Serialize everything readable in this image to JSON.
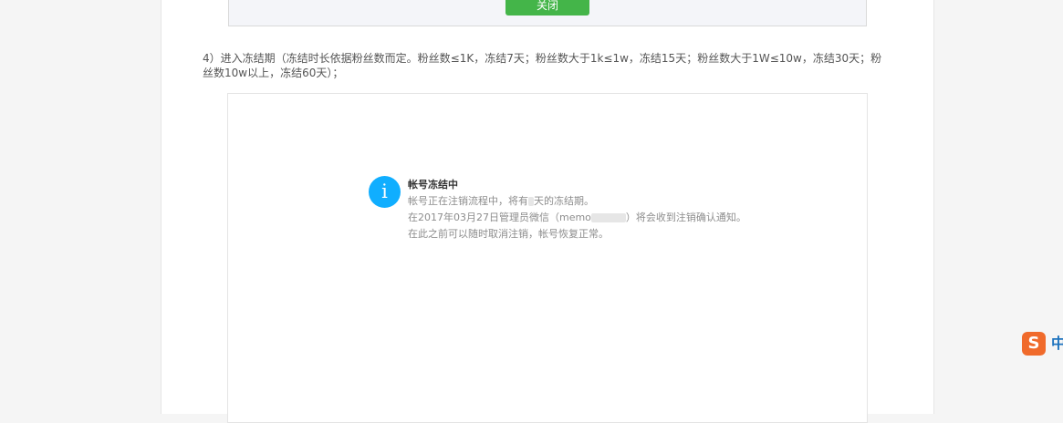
{
  "top_shot": {
    "close_label": "关闭"
  },
  "step": {
    "text": "4）进入冻结期（冻结时长依据粉丝数而定。粉丝数≤1K，冻结7天；粉丝数大于1k≤1w，冻结15天；粉丝数大于1W≤10w，冻结30天；粉丝数10w以上，冻结60天）；"
  },
  "notice": {
    "icon": "i",
    "title": "帐号冻结中",
    "line1_a": "帐号正在注销流程中，将有",
    "line1_blur": "7",
    "line1_b": "天的冻结期。",
    "line2_a": "在2017年03月27日管理员微信（memo",
    "line2_blur": "xxxxxx",
    "line2_b": "）将会收到注销确认通知。",
    "line3": "在此之前可以随时取消注销，帐号恢复正常。"
  },
  "ime": {
    "logo": "S",
    "label": "中"
  }
}
